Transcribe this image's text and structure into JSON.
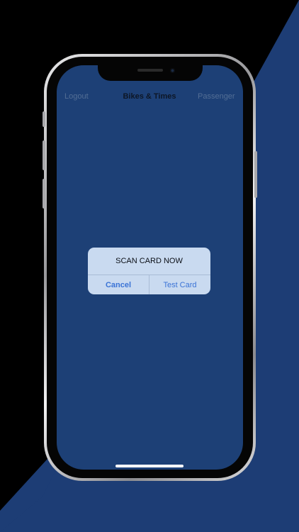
{
  "colors": {
    "background_dark": "#000000",
    "background_blue": "#1d3d75",
    "screen_background": "#1d4076",
    "alert_background": "#c9daf0",
    "alert_button_text": "#3a73d6"
  },
  "nav": {
    "left_label": "Logout",
    "title": "Bikes & Times",
    "right_label": "Passenger"
  },
  "alert": {
    "title": "SCAN CARD NOW",
    "cancel_label": "Cancel",
    "test_label": "Test Card"
  }
}
